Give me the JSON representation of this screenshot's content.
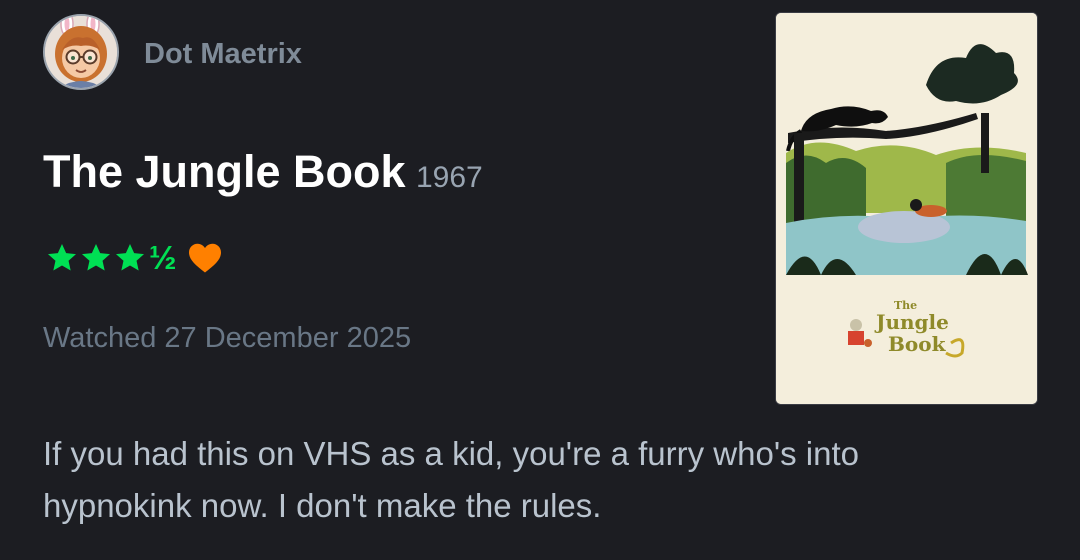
{
  "user": {
    "name": "Dot Maetrix"
  },
  "film": {
    "title": "The Jungle Book",
    "year": "1967",
    "poster_logo": "The Jungle Book"
  },
  "rating": {
    "stars": 3.5,
    "max": 5,
    "half_glyph": "½",
    "liked": true,
    "star_color": "#00e054",
    "heart_color": "#ff8000"
  },
  "watched": {
    "label": "Watched 27 December 2025"
  },
  "review": {
    "lines": [
      "If you had this on VHS as a kid, you're a furry who's into",
      "hypnokink now. I don't make the rules."
    ]
  },
  "colors": {
    "background": "#1c1d22",
    "title": "#ffffff",
    "muted": "#697786"
  }
}
